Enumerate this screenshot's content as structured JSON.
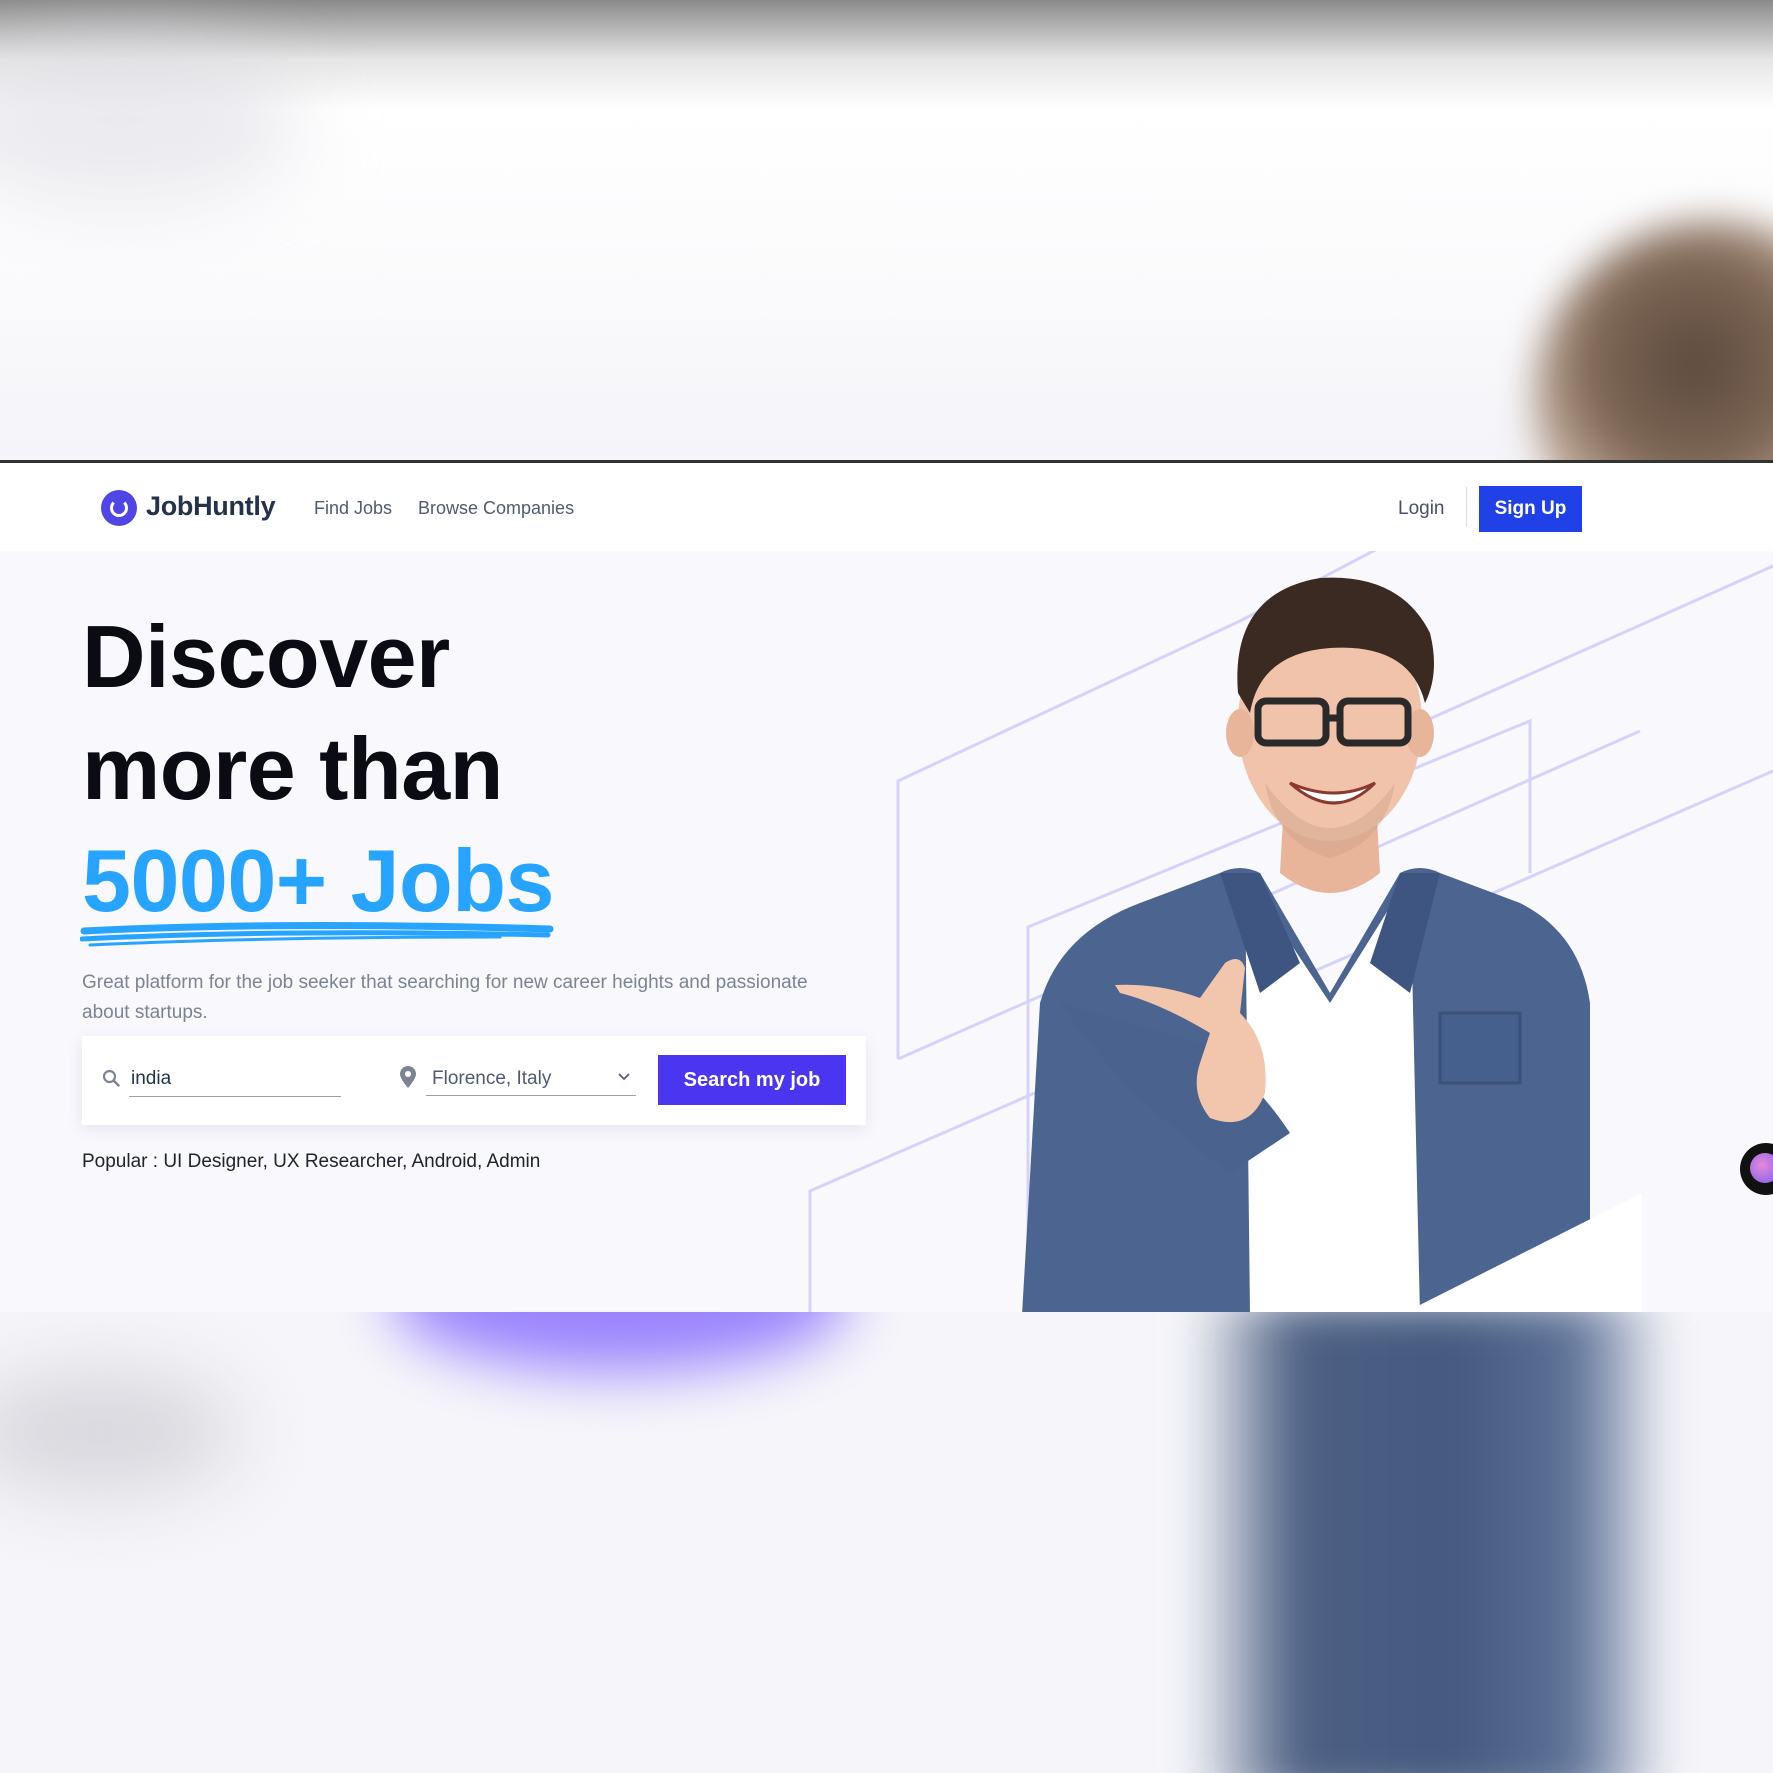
{
  "nav": {
    "brand": "JobHuntly",
    "links": [
      "Find Jobs",
      "Browse Companies"
    ],
    "login": "Login",
    "signup": "Sign Up"
  },
  "hero": {
    "line1": "Discover",
    "line2": "more than",
    "highlight": "5000+ Jobs",
    "description": "Great platform for the job seeker that searching for new career heights and passionate about startups."
  },
  "search": {
    "query_value": "india",
    "location_value": "Florence, Italy",
    "button_label": "Search my job"
  },
  "popular": "Popular : UI Designer, UX Researcher, Android, Admin",
  "colors": {
    "primary": "#4a36f0",
    "signup": "#2040e8",
    "highlight": "#26a4ff",
    "heading": "#0b0b14"
  },
  "icons": [
    "logo-icon",
    "search-icon",
    "location-pin-icon",
    "chevron-down-icon",
    "chat-icon"
  ]
}
